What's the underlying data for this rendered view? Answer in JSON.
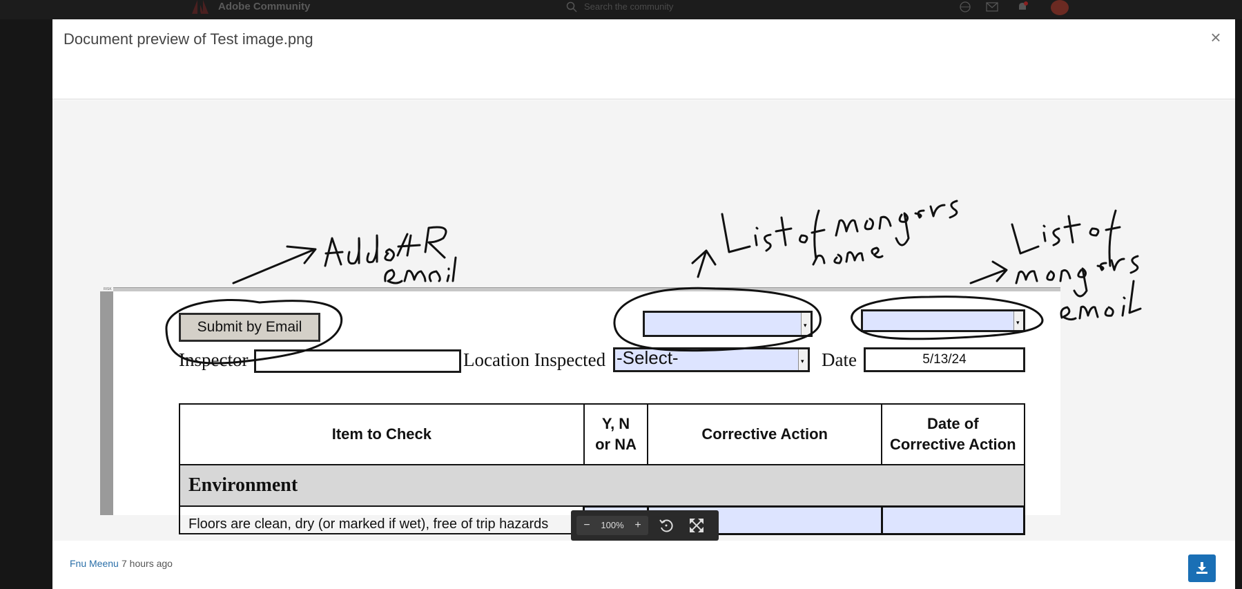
{
  "background_header": {
    "site_title": "Adobe Community",
    "search_placeholder": "Search the community"
  },
  "modal": {
    "title": "Document preview of Test image.png",
    "close_label": "×"
  },
  "document": {
    "tiny_label": "RISK",
    "submit_button": "Submit by Email",
    "inspector_label": "Inspector",
    "location_label": "Location Inspected",
    "location_select_value": "-Select-",
    "date_label": "Date",
    "date_value": "5/13/24",
    "table": {
      "headers": [
        "Item to Check",
        "Y, N or NA",
        "Corrective Action",
        "Date of Corrective Action"
      ],
      "header_lines": [
        [
          "Item to Check"
        ],
        [
          "Y, N",
          "or NA"
        ],
        [
          "Corrective Action"
        ],
        [
          "Date of",
          "Corrective Action"
        ]
      ],
      "section": "Environment",
      "rows": [
        {
          "item": "Floors are clean, dry (or marked if wet), free of trip hazards"
        }
      ]
    },
    "annotations": {
      "hr_email": [
        "Added HR",
        "email"
      ],
      "managers_name": [
        "List of managers",
        "name"
      ],
      "managers_email": [
        "List of",
        "managers",
        "email"
      ]
    }
  },
  "toolbar": {
    "zoom_out": "−",
    "zoom_level": "100%",
    "zoom_in": "+",
    "rotate": "rotate-icon",
    "fullscreen": "expand-icon"
  },
  "footer": {
    "author": "Fnu Meenu",
    "time": "7 hours ago",
    "download_icon": "download-icon"
  },
  "colors": {
    "modal_bg": "#ffffff",
    "preview_bg": "#f4f4f4",
    "field_blue": "#dde4ff",
    "accent": "#1a6fb5"
  }
}
